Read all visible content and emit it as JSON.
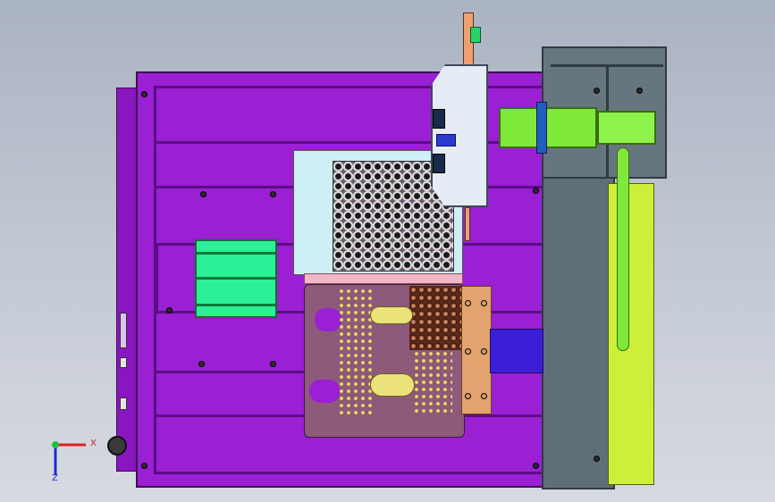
{
  "viewport": {
    "axis_x_label": "X",
    "axis_y_label": "Y",
    "axis_z_label": "Z"
  },
  "colors": {
    "frame": "#9b1fd3",
    "column": "#5f6f78",
    "lime": "#ccf03a",
    "tray": "#cfeff6",
    "board": "#8e5a7a",
    "accent_green": "#2bf095",
    "blue_plate": "#3b1fd8"
  },
  "icons": {
    "triad": "coordinate-triad-icon"
  }
}
